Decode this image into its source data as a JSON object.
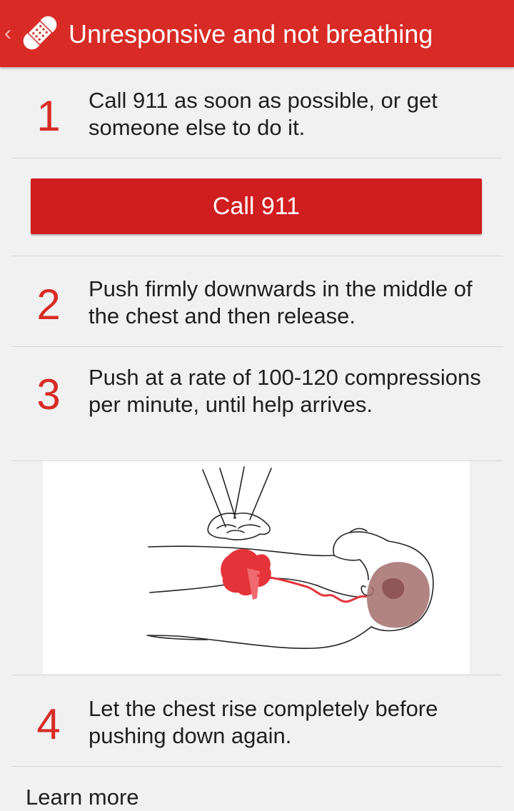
{
  "header": {
    "back_glyph": "‹",
    "title": "Unresponsive and not breathing",
    "icon": "bandage-icon",
    "bar_color": "#d82b26"
  },
  "steps": [
    {
      "number": "1",
      "text": "Call 911 as soon as possible, or get someone else to do it."
    },
    {
      "number": "2",
      "text": "Push firmly downwards in the middle of the chest and then release."
    },
    {
      "number": "3",
      "text": "Push at a rate of 100-120 compressions per minute, until help arrives."
    },
    {
      "number": "4",
      "text": "Let the chest rise completely before pushing down again."
    }
  ],
  "call_button": {
    "label": "Call 911",
    "color": "#d01d1f"
  },
  "illustration": {
    "icon": "cpr-illustration"
  },
  "learn_more": {
    "label": "Learn more"
  },
  "colors": {
    "accent": "#d82b26",
    "background": "#f1f1f1",
    "divider": "#d8d8d8"
  }
}
